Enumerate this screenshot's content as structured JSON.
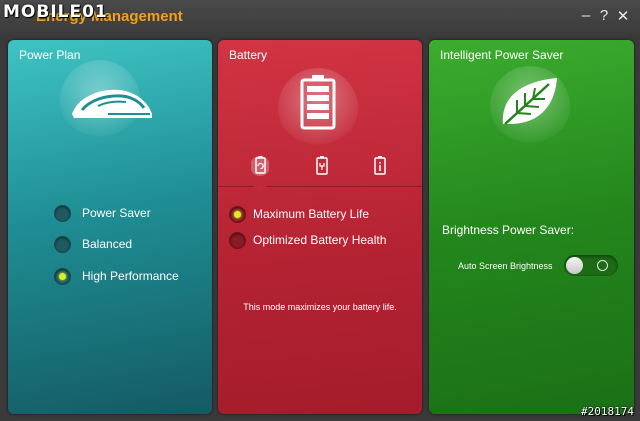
{
  "watermark": "MOBILE01",
  "badge": "#2018174",
  "titlebar": {
    "app_title": "Energy Management",
    "minimize": "–",
    "help": "?",
    "close": "✕"
  },
  "power_plan": {
    "title": "Power Plan",
    "icon": "speeding-train-icon",
    "options": [
      {
        "label": "Power Saver",
        "selected": false
      },
      {
        "label": "Balanced",
        "selected": false
      },
      {
        "label": "High Performance",
        "selected": true
      }
    ]
  },
  "battery": {
    "title": "Battery",
    "icon": "battery-full-icon",
    "tabs": [
      {
        "icon": "battery-refresh-icon",
        "active": true
      },
      {
        "icon": "battery-plug-icon",
        "active": false
      },
      {
        "icon": "battery-info-icon",
        "active": false
      }
    ],
    "options": [
      {
        "label": "Maximum Battery Life",
        "selected": true
      },
      {
        "label": "Optimized Battery Health",
        "selected": false
      }
    ],
    "description": "This mode maximizes your battery life."
  },
  "intelligent": {
    "title": "Intelligent Power Saver",
    "icon": "leaf-icon",
    "brightness_title": "Brightness Power Saver:",
    "toggle_label": "Auto Screen Brightness",
    "toggle_on": false
  },
  "colors": {
    "teal": "#1f8f95",
    "red": "#b32232",
    "green": "#23861c",
    "title_orange": "#f0a020",
    "radio_on": "#d8f020"
  }
}
